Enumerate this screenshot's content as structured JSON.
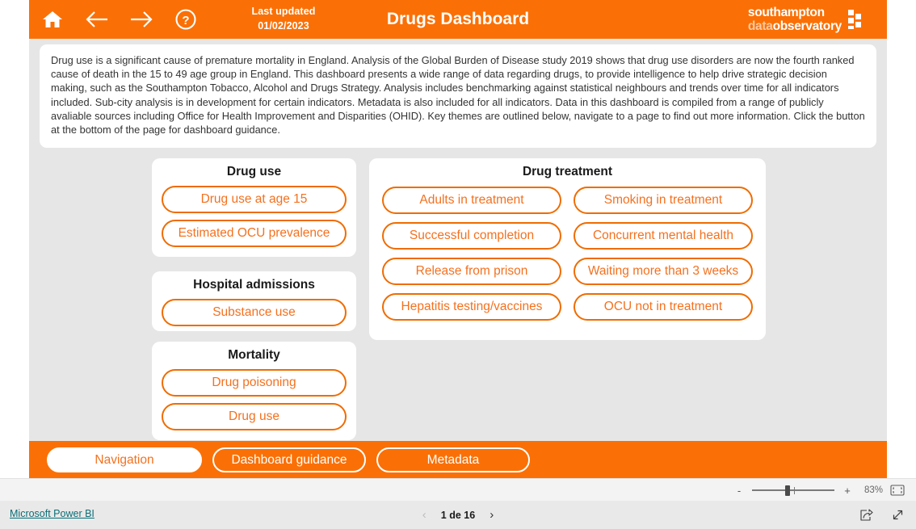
{
  "header": {
    "title": "Drugs Dashboard",
    "last_updated_label": "Last updated",
    "last_updated_date": "01/02/2023",
    "icons": {
      "home": "home-icon",
      "back": "back-arrow-icon",
      "forward": "forward-arrow-icon",
      "help": "help-icon"
    },
    "logo": {
      "line1_a": "southampton",
      "line2_a": "data",
      "line2_b": "observatory"
    },
    "accent_color": "#FA7006"
  },
  "intro": {
    "text": "Drug use is a significant cause of premature mortality in England. Analysis of the Global Burden of Disease study 2019 shows that drug use disorders are now the fourth ranked cause of death in the 15 to 49 age group in England. This dashboard presents a wide range of data regarding drugs, to provide intelligence to help drive strategic decision making, such as the Southampton Tobacco, Alcohol and Drugs Strategy. Analysis includes benchmarking against statistical neighbours and trends over time for all indicators included. Sub-city analysis is in development for certain indicators. Metadata is also included for all indicators. Data in this dashboard is compiled from a range of publicly avaliable sources including Office for Health Improvement and Disparities (OHID). Key themes are outlined below, navigate to a page to find out more information. Click the button at the bottom of the page for dashboard guidance."
  },
  "cards": {
    "drug_use": {
      "title": "Drug use",
      "buttons": [
        "Drug use at age 15",
        "Estimated OCU prevalence"
      ]
    },
    "hospital_admissions": {
      "title": "Hospital admissions",
      "buttons": [
        "Substance use"
      ]
    },
    "mortality": {
      "title": "Mortality",
      "buttons": [
        "Drug poisoning",
        "Drug use"
      ]
    },
    "drug_treatment": {
      "title": "Drug treatment",
      "buttons": [
        "Adults in treatment",
        "Smoking in treatment",
        "Successful completion",
        "Concurrent mental health",
        "Release from prison",
        "Waiting more than 3 weeks",
        "Hepatitis testing/vaccines",
        "OCU not in treatment"
      ]
    }
  },
  "navbar": {
    "buttons": [
      {
        "label": "Navigation",
        "active": true
      },
      {
        "label": "Dashboard guidance",
        "active": false
      },
      {
        "label": "Metadata",
        "active": false
      }
    ]
  },
  "statusbar": {
    "zoom_out_label": "-",
    "zoom_in_label": "+",
    "zoom_percent": "83%",
    "fit_to_page_icon": "fit-to-page-icon"
  },
  "footer": {
    "brand_link": "Microsoft Power BI",
    "page_label": "1 de 16",
    "prev_chevron": "‹",
    "next_chevron": "›",
    "share_icon": "share-icon",
    "fullscreen_icon": "fullscreen-icon"
  }
}
